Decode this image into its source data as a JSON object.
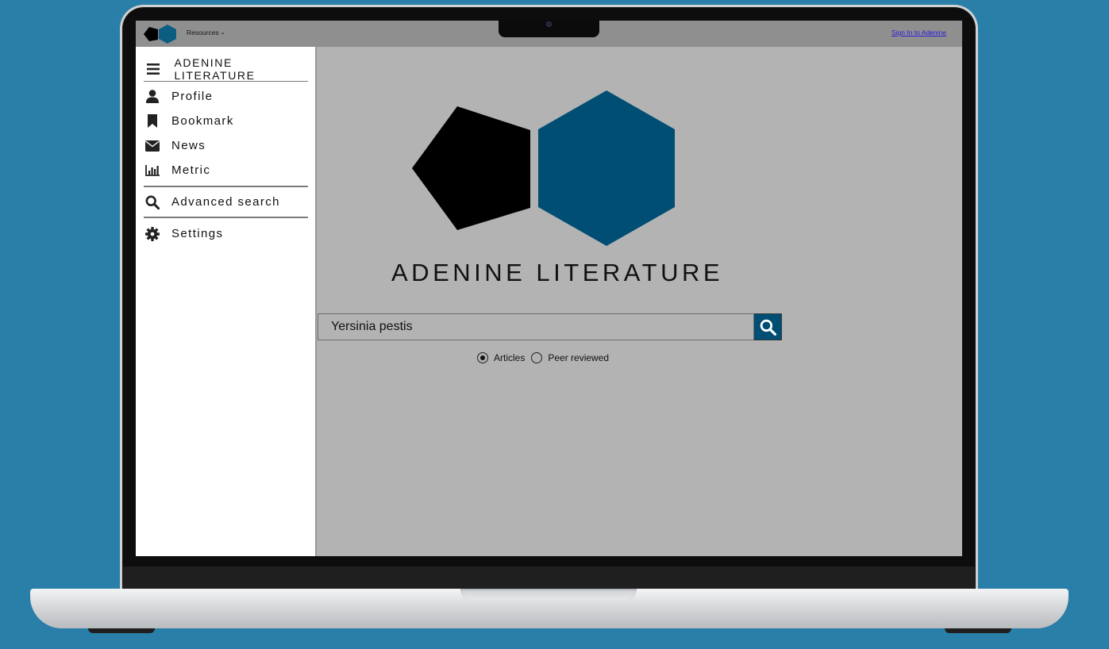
{
  "topbar": {
    "resources_label": "Resources",
    "signin_label": "Sign In to Adenine"
  },
  "sidebar": {
    "title": "ADENINE LITERATURE",
    "items": [
      {
        "label": "Profile",
        "icon": "user-icon"
      },
      {
        "label": "Bookmark",
        "icon": "bookmark-icon"
      },
      {
        "label": "News",
        "icon": "envelope-icon"
      },
      {
        "label": "Metric",
        "icon": "bar-chart-icon"
      },
      {
        "label": "Advanced search",
        "icon": "search-icon"
      },
      {
        "label": "Settings",
        "icon": "gear-icon"
      }
    ]
  },
  "main": {
    "brand": "ADENINE LITERATURE",
    "search_value": "Yersinia pestis",
    "filters": [
      {
        "label": "Articles",
        "checked": true
      },
      {
        "label": "Peer reviewed",
        "checked": false
      }
    ]
  },
  "colors": {
    "accent": "#004e74",
    "background": "#2a7fa9",
    "screen": "#b3b3b3",
    "topbar": "#8f8f8f"
  }
}
